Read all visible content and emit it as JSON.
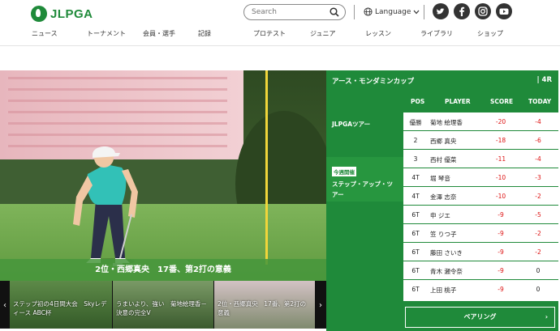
{
  "header": {
    "logo_text": "JLPGA",
    "search_placeholder": "Search",
    "language_label": "Language",
    "social": [
      "twitter-icon",
      "facebook-icon",
      "instagram-icon",
      "youtube-icon"
    ]
  },
  "nav": [
    "ニュース",
    "トーナメント",
    "会員・選手",
    "記録",
    "プロテスト",
    "ジュニア",
    "レッスン",
    "ライブラリ",
    "ショップ"
  ],
  "hero": {
    "caption": "2位・西郷真央　17番、第2打の意義",
    "thumbs": [
      "ステップ初の4日間大会　Skyレディース ABC杯",
      "うまいより、強い　菊地絵理香－決意の完全V",
      "2位・西郷真央　17番、第2打の意義",
      ""
    ]
  },
  "leaderboard": {
    "title": "アース・モンダミンカップ",
    "round": "| 4R",
    "columns": {
      "pos": "POS",
      "player": "PLAYER",
      "score": "SCORE",
      "today": "TODAY"
    },
    "tour_label": "JLPGAツアー",
    "this_week_badge": "今週開催",
    "this_week_name": "ステップ・アップ・ツアー",
    "rows": [
      {
        "pos": "優勝",
        "player": "菊地 絵理香",
        "score": "-20",
        "today": "-4"
      },
      {
        "pos": "2",
        "player": "西郷 真央",
        "score": "-18",
        "today": "-6"
      },
      {
        "pos": "3",
        "player": "西村 優菜",
        "score": "-11",
        "today": "-4"
      },
      {
        "pos": "4T",
        "player": "堀 琴音",
        "score": "-10",
        "today": "-3"
      },
      {
        "pos": "4T",
        "player": "金澤 志奈",
        "score": "-10",
        "today": "-2"
      },
      {
        "pos": "6T",
        "player": "申 ジエ",
        "score": "-9",
        "today": "-5"
      },
      {
        "pos": "6T",
        "player": "笠 りつ子",
        "score": "-9",
        "today": "-2"
      },
      {
        "pos": "6T",
        "player": "藤田 さいき",
        "score": "-9",
        "today": "-2"
      },
      {
        "pos": "6T",
        "player": "青木 瀬令奈",
        "score": "-9",
        "today": "0"
      },
      {
        "pos": "6T",
        "player": "上田 桃子",
        "score": "-9",
        "today": "0"
      }
    ],
    "pairing_label": "ペアリング",
    "pairing_chevron": "›"
  },
  "colors": {
    "brand_green": "#1f8a3a",
    "score_red": "#dd1111"
  }
}
